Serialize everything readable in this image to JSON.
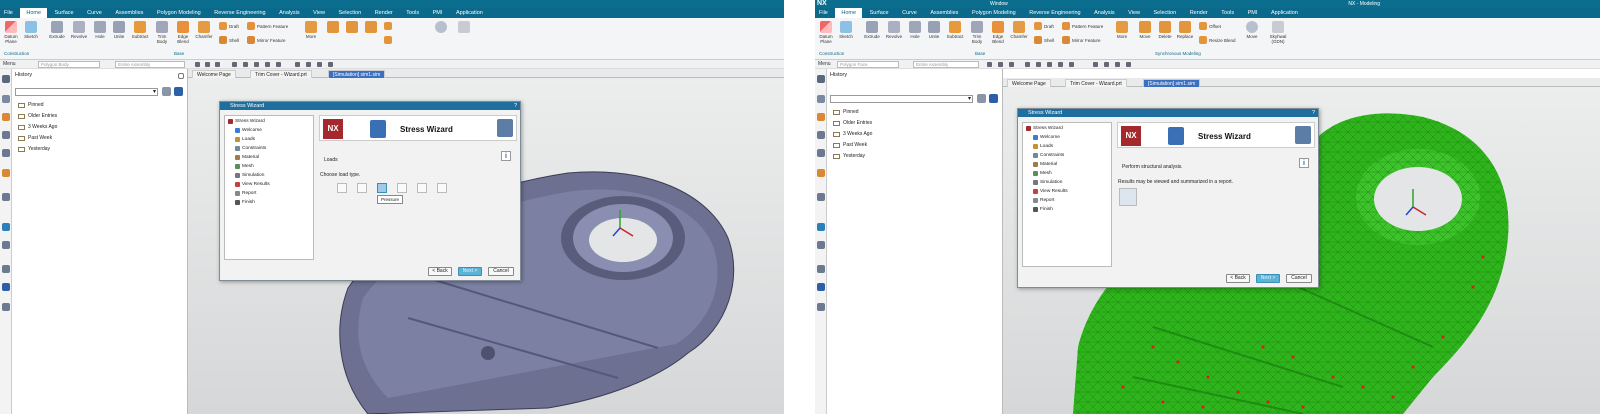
{
  "windows": [
    {
      "title": "",
      "app_logo": "",
      "menu": [
        "File",
        "Home",
        "Surface",
        "Curve",
        "Assemblies",
        "Polygon Modeling",
        "Reverse Engineering",
        "Analysis",
        "View",
        "Selection",
        "Render",
        "Tools",
        "PMI",
        "Application"
      ],
      "active_menu": "Home",
      "ribbon_tools": [
        "Datum Plane",
        "Sketch",
        "Extrude",
        "Revolve",
        "Hole",
        "Unite",
        "Subtract",
        "Trim Body",
        "Edge Blend",
        "Chamfer",
        "Draft",
        "Shell",
        "Pattern Feature",
        "Mirror Feature",
        "More"
      ],
      "ribbon_groups": [
        "Construction",
        "Base"
      ],
      "quick": {
        "menu": "Menu",
        "filter1": "Polygon Body",
        "filter2": "Entire Assembly"
      },
      "nav": {
        "history": "History",
        "items": [
          "Pinned",
          "Older Entries",
          "3 Weeks Ago",
          "Past Week",
          "Yesterday"
        ]
      },
      "tabs": [
        "Welcome Page",
        "Trim Cover - Wizard.prt",
        "[Simulation] sim1.sim"
      ],
      "dialog": {
        "title": "Stress Wizard",
        "tree": [
          "Stress Wizard",
          "Welcome",
          "Loads",
          "Constraints",
          "Material",
          "Mesh",
          "Simulation",
          "View Results",
          "Report",
          "Finish"
        ],
        "banner_title": "Stress Wizard",
        "section": "Loads",
        "prompt": "Choose load type.",
        "tooltip": "Pressure",
        "buttons": {
          "back": "< Back",
          "next": "Next >",
          "cancel": "Cancel"
        }
      }
    },
    {
      "title": "NX - Modeling",
      "app_logo": "NX",
      "quick_title": "Window",
      "menu": [
        "File",
        "Home",
        "Surface",
        "Curve",
        "Assemblies",
        "Polygon Modeling",
        "Reverse Engineering",
        "Analysis",
        "View",
        "Selection",
        "Render",
        "Tools",
        "PMI",
        "Application"
      ],
      "active_menu": "Home",
      "ribbon_tools": [
        "Datum Plane",
        "Sketch",
        "Extrude",
        "Revolve",
        "Hole",
        "Unite",
        "Subtract",
        "Trim Body",
        "Edge Blend",
        "Chamfer",
        "Offset",
        "Move",
        "Delete",
        "Replace",
        "Resize Blend",
        "Draft",
        "Shell",
        "Pattern Feature",
        "Mirror Feature",
        "More",
        "Move",
        "More",
        "Skyhwal (GDN)"
      ],
      "ribbon_groups": [
        "Construction",
        "Base",
        "Synchronous Modeling"
      ],
      "quick": {
        "menu": "Menu",
        "filter1": "Polygon Face",
        "filter2": "Entire Assembly"
      },
      "nav": {
        "history": "History",
        "items": [
          "Pinned",
          "Older Entries",
          "3 Weeks Ago",
          "Past Week",
          "Yesterday"
        ]
      },
      "tabs": [
        "Welcome Page",
        "Trim Cover - Wizard.prt",
        "[Simulation] sim1.sim"
      ],
      "dialog": {
        "title": "Stress Wizard",
        "tree": [
          "Stress Wizard",
          "Welcome",
          "Loads",
          "Constraints",
          "Material",
          "Mesh",
          "Simulation",
          "View Results",
          "Report",
          "Finish"
        ],
        "banner_title": "Stress Wizard",
        "section": "Perform structural analysis.",
        "prompt": "Results may be viewed and summarized in a report.",
        "buttons": {
          "back": "< Back",
          "next": "Next >",
          "cancel": "Cancel"
        }
      }
    }
  ],
  "colors": {
    "titlebar": "#0c6e8f",
    "menubar": "#0b6a8b",
    "dialog_title": "#1f6f9e",
    "part_grey": "#6d7091",
    "part_green": "#2fb51c",
    "nx_red": "#a5282c",
    "next_button": "#5bb3d8"
  }
}
